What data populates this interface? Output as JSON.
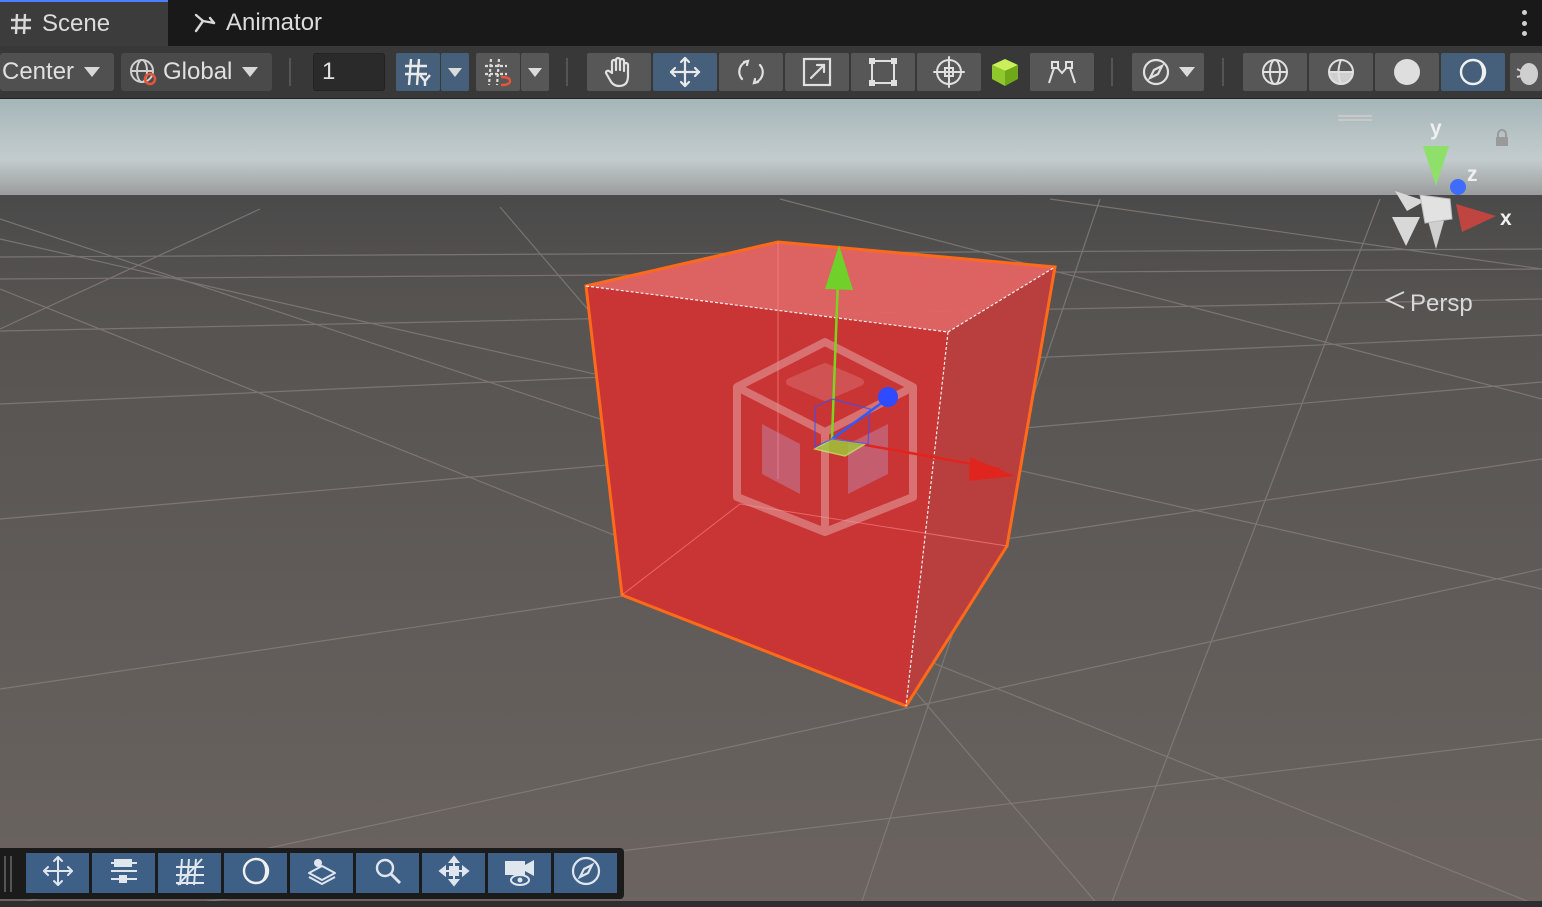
{
  "tabs": [
    {
      "label": "Scene",
      "icon": "grid-hash-icon",
      "active": true
    },
    {
      "label": "Animator",
      "icon": "animator-icon",
      "active": false
    }
  ],
  "toolbar": {
    "pivot_label": "Center",
    "space_label": "Global",
    "snap_increment": "1",
    "transform_tools": [
      "hand-tool",
      "move-tool",
      "rotate-tool",
      "scale-tool",
      "rect-tool",
      "transform-tool",
      "custom-tool",
      "component-tool"
    ],
    "active_tool": "move-tool",
    "shading_modes": [
      "wireframe",
      "shaded-wireframe",
      "shaded",
      "lighting"
    ]
  },
  "viewport": {
    "projection_label": "Persp",
    "gizmo_axes": {
      "y": "y",
      "z": "z",
      "x": "x"
    },
    "selection_color": "#ff6a1a",
    "cube_color": "#cf3a3a",
    "axis_colors": {
      "x": "#e0251f",
      "y": "#7ed321",
      "z": "#2e5bff"
    }
  },
  "overlay_toolbar": {
    "buttons": [
      "tool-settings",
      "transform-settings",
      "grid-settings",
      "lighting-overlay",
      "layers",
      "search",
      "orientation",
      "camera",
      "navigation"
    ]
  }
}
